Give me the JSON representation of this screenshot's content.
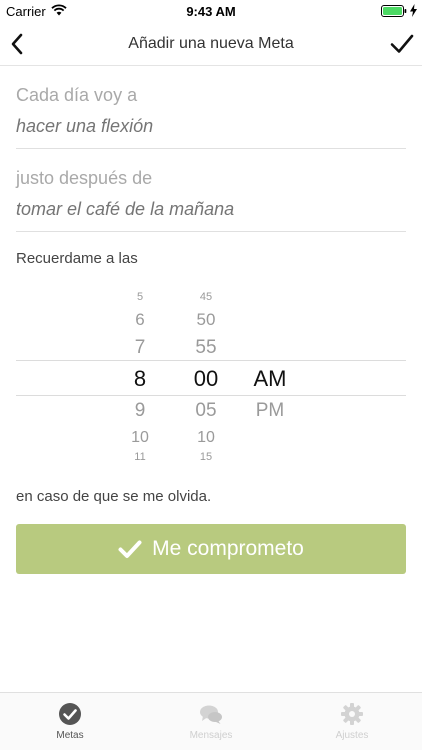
{
  "status_bar": {
    "carrier": "Carrier",
    "time": "9:43 AM"
  },
  "nav": {
    "title": "Añadir una nueva Meta"
  },
  "form": {
    "daily_label": "Cada día voy a",
    "daily_placeholder": "hacer una flexión",
    "after_label": "justo después de",
    "after_placeholder": "tomar el café de la mañana",
    "reminder_label": "Recuerdame a las",
    "note": "en caso de que se me olvida."
  },
  "picker": {
    "hours": [
      "5",
      "6",
      "7",
      "8",
      "9",
      "10",
      "11"
    ],
    "minutes": [
      "45",
      "50",
      "55",
      "00",
      "05",
      "10",
      "15"
    ],
    "periods": [
      "AM",
      "PM"
    ],
    "selected_hour": "8",
    "selected_minute": "00",
    "selected_period": "AM"
  },
  "commit_button": {
    "label": "Me comprometo"
  },
  "tabs": [
    {
      "label": "Metas",
      "icon": "check-circle-icon",
      "active": true
    },
    {
      "label": "Mensajes",
      "icon": "chat-bubbles-icon",
      "active": false
    },
    {
      "label": "Ajustes",
      "icon": "gear-icon",
      "active": false
    }
  ],
  "colors": {
    "accent_green": "#b8ca7f",
    "placeholder": "#c9c9c9",
    "label_gray": "#a9a9a9"
  }
}
